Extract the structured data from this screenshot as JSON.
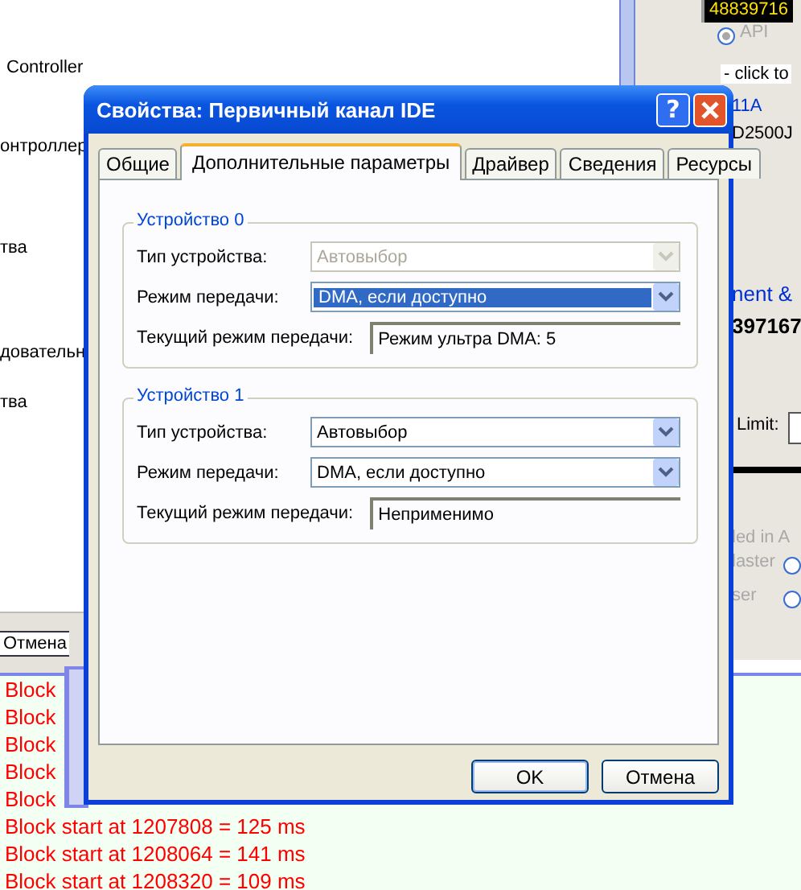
{
  "background": {
    "device_list": [
      "Controller",
      "онтроллер",
      "тва",
      "довательн",
      "тва"
    ],
    "side_panel": {
      "counter": "48839716",
      "hint": "- click to",
      "model_a": "11A",
      "model_b": "D2500J",
      "section": "nent &",
      "serial": "397167",
      "limit_label": "Limit:",
      "disabled_a": "led in A",
      "radios": [
        {
          "label": "API",
          "selected": true
        },
        {
          "label": "laster",
          "selected": false
        },
        {
          "label": "ser",
          "selected": false
        }
      ]
    },
    "cancel_button": "Отмена",
    "log_lines": [
      "Block",
      "Block",
      "Block",
      "Block",
      "Block",
      "Block start at 1207808 = 125 ms",
      "Block start at 1208064 = 141 ms",
      "Block start at 1208320 = 109 ms"
    ]
  },
  "dialog": {
    "title": "Свойства: Первичный канал IDE",
    "help_button": "?",
    "tabs": [
      {
        "label": "Общие",
        "selected": false
      },
      {
        "label": "Дополнительные параметры",
        "selected": true
      },
      {
        "label": "Драйвер",
        "selected": false
      },
      {
        "label": "Сведения",
        "selected": false
      },
      {
        "label": "Ресурсы",
        "selected": false
      }
    ],
    "groups": [
      {
        "title": "Устройство 0",
        "rows": [
          {
            "kind": "combo",
            "label": "Тип устройства:",
            "value": "Автовыбор",
            "disabled": true,
            "selected": false
          },
          {
            "kind": "combo",
            "label": "Режим передачи:",
            "value": "DMA, если доступно",
            "disabled": false,
            "selected": true
          },
          {
            "kind": "readout",
            "label": "Текущий режим передачи:",
            "value": "Режим ультра DMA: 5"
          }
        ]
      },
      {
        "title": "Устройство 1",
        "rows": [
          {
            "kind": "combo",
            "label": "Тип устройства:",
            "value": "Автовыбор",
            "disabled": false,
            "selected": false
          },
          {
            "kind": "combo",
            "label": "Режим передачи:",
            "value": "DMA, если доступно",
            "disabled": false,
            "selected": false
          },
          {
            "kind": "readout",
            "label": "Текущий режим передачи:",
            "value": "Неприменимо"
          }
        ]
      }
    ],
    "buttons": [
      "OK",
      "Отмена"
    ]
  }
}
